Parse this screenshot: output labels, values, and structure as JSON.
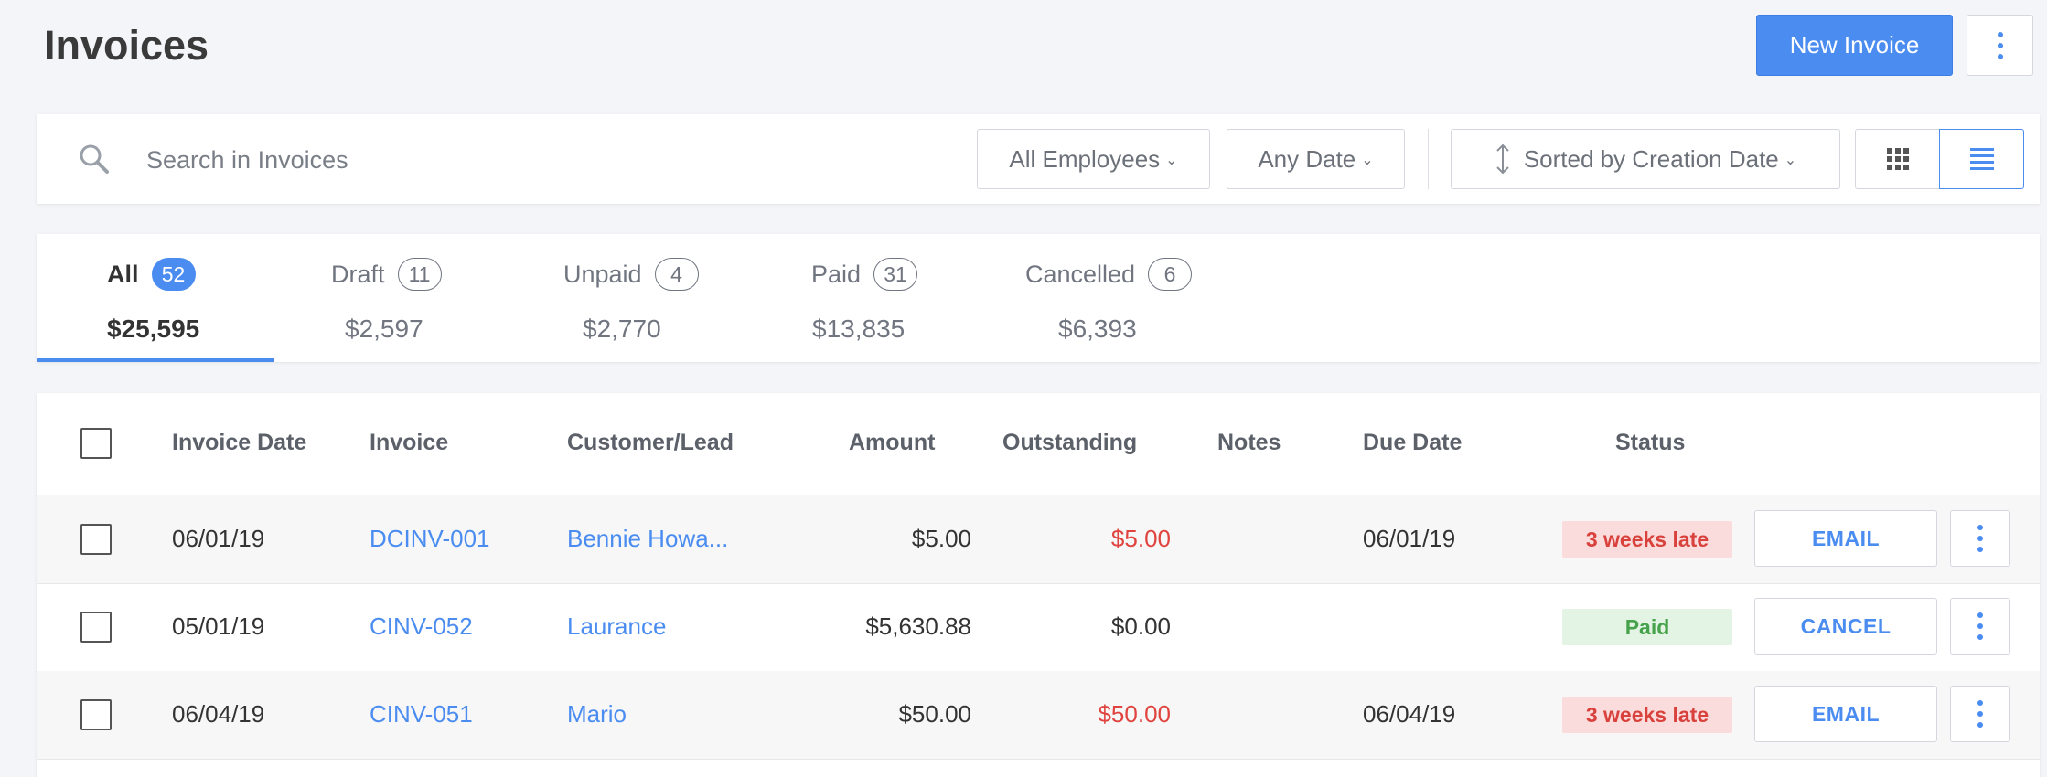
{
  "page": {
    "title": "Invoices"
  },
  "header": {
    "new_invoice_label": "New Invoice"
  },
  "toolbar": {
    "search_placeholder": "Search in Invoices",
    "employees_label": "All Employees",
    "date_label": "Any Date",
    "sort_label": "Sorted by Creation Date"
  },
  "tabs": [
    {
      "label": "All",
      "count": "52",
      "amount": "$25,595",
      "active": true
    },
    {
      "label": "Draft",
      "count": "11",
      "amount": "$2,597",
      "active": false
    },
    {
      "label": "Unpaid",
      "count": "4",
      "amount": "$2,770",
      "active": false
    },
    {
      "label": "Paid",
      "count": "31",
      "amount": "$13,835",
      "active": false
    },
    {
      "label": "Cancelled",
      "count": "6",
      "amount": "$6,393",
      "active": false
    }
  ],
  "table": {
    "columns": [
      "Invoice Date",
      "Invoice",
      "Customer/Lead",
      "Amount",
      "Outstanding",
      "Notes",
      "Due Date",
      "Status"
    ],
    "rows": [
      {
        "invoice_date": "06/01/19",
        "invoice": "DCINV-001",
        "customer": "Bennie Howa...",
        "amount": "$5.00",
        "outstanding": "$5.00",
        "notes": "",
        "due_date": "06/01/19",
        "status": "3 weeks late",
        "action": "EMAIL"
      },
      {
        "invoice_date": "05/01/19",
        "invoice": "CINV-052",
        "customer": "Laurance",
        "amount": "$5,630.88",
        "outstanding": "$0.00",
        "notes": "",
        "due_date": "",
        "status": "Paid",
        "action": "CANCEL"
      },
      {
        "invoice_date": "06/04/19",
        "invoice": "CINV-051",
        "customer": "Mario",
        "amount": "$50.00",
        "outstanding": "$50.00",
        "notes": "",
        "due_date": "06/04/19",
        "status": "3 weeks late",
        "action": "EMAIL"
      }
    ]
  },
  "colors": {
    "accent": "#4a8cf0",
    "late_bg": "#f9dcdb",
    "late_text": "#d9413c",
    "paid_bg": "#e3f3e4",
    "paid_text": "#47a34b"
  },
  "icons": [
    "search-icon",
    "chevron-down-icon",
    "sort-icon",
    "grid-view-icon",
    "list-view-icon",
    "more-vertical-icon"
  ]
}
